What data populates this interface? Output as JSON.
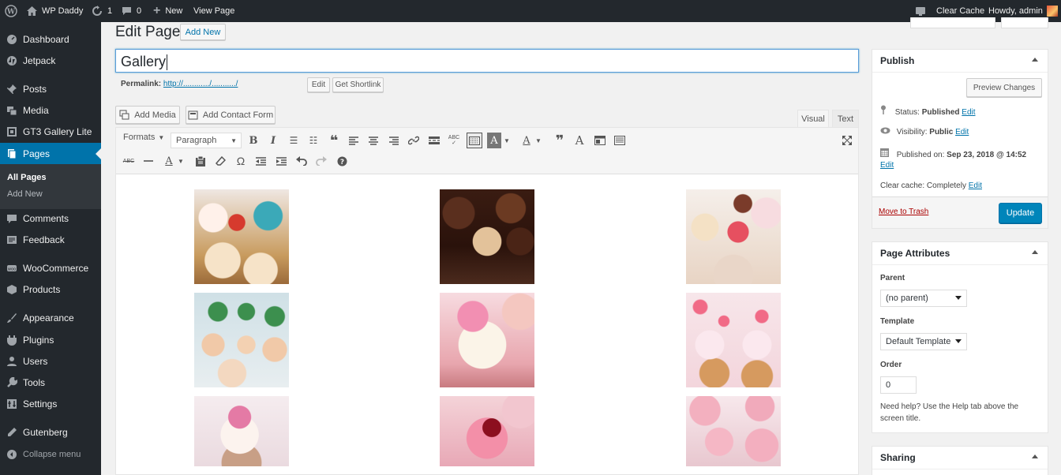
{
  "adminbar": {
    "site_name": "WP Daddy",
    "updates_count": "1",
    "comments_count": "0",
    "new_label": "New",
    "view_page_label": "View Page",
    "clear_cache_label": "Clear Cache",
    "howdy_label": "Howdy, admin"
  },
  "sidebar": {
    "items": [
      {
        "label": "Dashboard",
        "icon": "dashboard-icon"
      },
      {
        "label": "Jetpack",
        "icon": "jetpack-icon"
      },
      {
        "label": "Posts",
        "icon": "pin-icon"
      },
      {
        "label": "Media",
        "icon": "media-icon"
      },
      {
        "label": "GT3 Gallery Lite",
        "icon": "gallery-icon"
      },
      {
        "label": "Pages",
        "icon": "pages-icon"
      },
      {
        "label": "Comments",
        "icon": "comment-icon"
      },
      {
        "label": "Feedback",
        "icon": "feedback-icon"
      },
      {
        "label": "WooCommerce",
        "icon": "woocommerce-icon"
      },
      {
        "label": "Products",
        "icon": "products-icon"
      },
      {
        "label": "Appearance",
        "icon": "brush-icon"
      },
      {
        "label": "Plugins",
        "icon": "plugin-icon"
      },
      {
        "label": "Users",
        "icon": "users-icon"
      },
      {
        "label": "Tools",
        "icon": "wrench-icon"
      },
      {
        "label": "Settings",
        "icon": "settings-icon"
      },
      {
        "label": "Gutenberg",
        "icon": "pencil-icon"
      },
      {
        "label": "Collapse menu",
        "icon": "collapse-icon"
      }
    ],
    "submenu": [
      "All Pages",
      "Add New"
    ]
  },
  "main": {
    "heading": "Edit Page",
    "add_new_label": "Add New",
    "title_value": "Gallery",
    "permalink_label": "Permalink:",
    "permalink_url": "http://............/.........../",
    "edit_label": "Edit",
    "shortlink_label": "Get Shortlink",
    "add_media_label": "Add Media",
    "add_contact_form_label": "Add Contact Form",
    "tab_visual": "Visual",
    "tab_text": "Text",
    "formats_label": "Formats",
    "paragraph_label": "Paragraph",
    "gallery_images": [
      "cupcakes-strawberry",
      "cupcakes-chocolate",
      "cupcakes-assorted",
      "cupcakes-mini-green",
      "cupcake-pink-flower",
      "cupcakes-pink-hearts",
      "cupcake-pink-rose",
      "cupcake-cherry",
      "cupcakes-pink-dots"
    ]
  },
  "publish": {
    "title": "Publish",
    "preview_label": "Preview Changes",
    "status_label": "Status:",
    "status_value": "Published",
    "status_edit": "Edit",
    "visibility_label": "Visibility:",
    "visibility_value": "Public",
    "visibility_edit": "Edit",
    "published_label": "Published on:",
    "published_value": "Sep 23, 2018 @ 14:52",
    "published_edit": "Edit",
    "cache_label": "Clear cache:",
    "cache_value": "Completely",
    "cache_edit": "Edit",
    "trash_label": "Move to Trash",
    "update_label": "Update"
  },
  "attributes": {
    "title": "Page Attributes",
    "parent_label": "Parent",
    "parent_value": "(no parent)",
    "template_label": "Template",
    "template_value": "Default Template",
    "order_label": "Order",
    "order_value": "0",
    "help_line1": "Need help? Use the Help tab above the",
    "help_line2": "screen title."
  },
  "sharing": {
    "title": "Sharing"
  },
  "colors": {
    "accent": "#0073aa",
    "adminbar": "#23282d",
    "update_button": "#0085ba",
    "trash": "#a00"
  }
}
